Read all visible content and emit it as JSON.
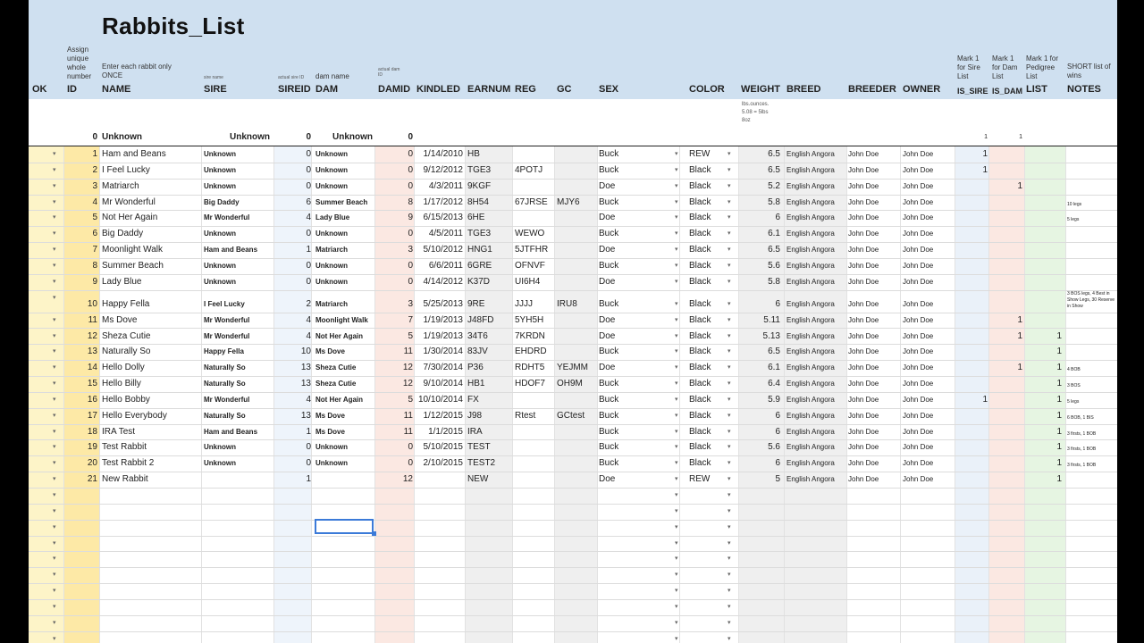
{
  "sheet_title": "Rabbits_List",
  "hints": {
    "id": "Assign\nunique\nwhole\nnumber",
    "name": "Enter each rabbit only\nONCE",
    "sire": "sire name",
    "sireid": "actual sire ID",
    "dam": "dam name",
    "damid": "actual dam\nID",
    "is_sire": "Mark 1\nfor Sire\nList",
    "is_dam": "Mark 1\nfor Dam\nList",
    "pedigree": "Mark 1 for\nPedigree\nList",
    "notes": "SHORT list of\nwins",
    "weight": "lbs.ounces.\n5.08 = 5lbs\n8oz"
  },
  "headers": {
    "ok": "OK",
    "id": "ID",
    "name": "NAME",
    "sire": "SIRE",
    "sireid": "SIREID",
    "dam": "DAM",
    "damid": "DAMID",
    "kindled": "KINDLED",
    "earnum": "EARNUM",
    "reg": "REG",
    "gc": "GC",
    "sex": "SEX",
    "color": "COLOR",
    "weight": "WEIGHT",
    "breed": "BREED",
    "breeder": "BREEDER",
    "owner": "OWNER",
    "is_sire": "IS_SIRE",
    "is_dam": "IS_DAM",
    "list": "LIST",
    "notes": "NOTES"
  },
  "row0": {
    "id": "0",
    "name": "Unknown",
    "sire": "Unknown",
    "sireid": "0",
    "dam": "Unknown",
    "damid": "0",
    "is_sire": "1",
    "is_dam": "1"
  },
  "rows": [
    {
      "id": "1",
      "name": "Ham and Beans",
      "sire": "Unknown",
      "sireid": "0",
      "dam": "Unknown",
      "damid": "0",
      "kindled": "1/14/2010",
      "earnum": "HB",
      "reg": "",
      "gc": "",
      "sex": "Buck",
      "color": "REW",
      "weight": "6.5",
      "breed": "English Angora",
      "breeder": "John Doe",
      "owner": "John Doe",
      "is_sire": "1",
      "is_dam": "",
      "list": "",
      "notes": ""
    },
    {
      "id": "2",
      "name": "I Feel Lucky",
      "sire": "Unknown",
      "sireid": "0",
      "dam": "Unknown",
      "damid": "0",
      "kindled": "9/12/2012",
      "earnum": "TGE3",
      "reg": "4POTJ",
      "gc": "",
      "sex": "Buck",
      "color": "Black",
      "weight": "6.5",
      "breed": "English Angora",
      "breeder": "John Doe",
      "owner": "John Doe",
      "is_sire": "1",
      "is_dam": "",
      "list": "",
      "notes": ""
    },
    {
      "id": "3",
      "name": "Matriarch",
      "sire": "Unknown",
      "sireid": "0",
      "dam": "Unknown",
      "damid": "0",
      "kindled": "4/3/2011",
      "earnum": "9KGF",
      "reg": "",
      "gc": "",
      "sex": "Doe",
      "color": "Black",
      "weight": "5.2",
      "breed": "English Angora",
      "breeder": "John Doe",
      "owner": "John Doe",
      "is_sire": "",
      "is_dam": "1",
      "list": "",
      "notes": ""
    },
    {
      "id": "4",
      "name": "Mr Wonderful",
      "sire": "Big Daddy",
      "sireid": "6",
      "dam": "Summer Beach",
      "damid": "8",
      "kindled": "1/17/2012",
      "earnum": "8H54",
      "reg": "67JRSE",
      "gc": "MJY6",
      "sex": "Buck",
      "color": "Black",
      "weight": "5.8",
      "breed": "English Angora",
      "breeder": "John Doe",
      "owner": "John Doe",
      "is_sire": "",
      "is_dam": "",
      "list": "",
      "notes": "10 legs"
    },
    {
      "id": "5",
      "name": "Not Her Again",
      "sire": "Mr Wonderful",
      "sireid": "4",
      "dam": "Lady Blue",
      "damid": "9",
      "kindled": "6/15/2013",
      "earnum": "6HE",
      "reg": "",
      "gc": "",
      "sex": "Doe",
      "color": "Black",
      "weight": "6",
      "breed": "English Angora",
      "breeder": "John Doe",
      "owner": "John Doe",
      "is_sire": "",
      "is_dam": "",
      "list": "",
      "notes": "5 legs"
    },
    {
      "id": "6",
      "name": "Big Daddy",
      "sire": "Unknown",
      "sireid": "0",
      "dam": "Unknown",
      "damid": "0",
      "kindled": "4/5/2011",
      "earnum": "TGE3",
      "reg": "WEWO",
      "gc": "",
      "sex": "Buck",
      "color": "Black",
      "weight": "6.1",
      "breed": "English Angora",
      "breeder": "John Doe",
      "owner": "John Doe",
      "is_sire": "",
      "is_dam": "",
      "list": "",
      "notes": ""
    },
    {
      "id": "7",
      "name": "Moonlight Walk",
      "sire": "Ham and Beans",
      "sireid": "1",
      "dam": "Matriarch",
      "damid": "3",
      "kindled": "5/10/2012",
      "earnum": "HNG1",
      "reg": "5JTFHR",
      "gc": "",
      "sex": "Doe",
      "color": "Black",
      "weight": "6.5",
      "breed": "English Angora",
      "breeder": "John Doe",
      "owner": "John Doe",
      "is_sire": "",
      "is_dam": "",
      "list": "",
      "notes": ""
    },
    {
      "id": "8",
      "name": "Summer Beach",
      "sire": "Unknown",
      "sireid": "0",
      "dam": "Unknown",
      "damid": "0",
      "kindled": "6/6/2011",
      "earnum": "6GRE",
      "reg": "OFNVF",
      "gc": "",
      "sex": "Buck",
      "color": "Black",
      "weight": "5.6",
      "breed": "English Angora",
      "breeder": "John Doe",
      "owner": "John Doe",
      "is_sire": "",
      "is_dam": "",
      "list": "",
      "notes": ""
    },
    {
      "id": "9",
      "name": "Lady Blue",
      "sire": "Unknown",
      "sireid": "0",
      "dam": "Unknown",
      "damid": "0",
      "kindled": "4/14/2012",
      "earnum": "K37D",
      "reg": "UI6H4",
      "gc": "",
      "sex": "Doe",
      "color": "Black",
      "weight": "5.8",
      "breed": "English Angora",
      "breeder": "John Doe",
      "owner": "John Doe",
      "is_sire": "",
      "is_dam": "",
      "list": "",
      "notes": ""
    },
    {
      "id": "10",
      "name": "Happy Fella",
      "sire": "I Feel Lucky",
      "sireid": "2",
      "dam": "Matriarch",
      "damid": "3",
      "kindled": "5/25/2013",
      "earnum": "9RE",
      "reg": "JJJJ",
      "gc": "IRU8",
      "sex": "Buck",
      "color": "Black",
      "weight": "6",
      "breed": "English Angora",
      "breeder": "John Doe",
      "owner": "John Doe",
      "is_sire": "",
      "is_dam": "",
      "list": "",
      "notes": "3 BOS legs, 4 Best in Show Legs, 30 Reserve in Show"
    },
    {
      "id": "11",
      "name": "Ms Dove",
      "sire": "Mr Wonderful",
      "sireid": "4",
      "dam": "Moonlight Walk",
      "damid": "7",
      "kindled": "1/19/2013",
      "earnum": "J48FD",
      "reg": "5YH5H",
      "gc": "",
      "sex": "Doe",
      "color": "Black",
      "weight": "5.11",
      "breed": "English Angora",
      "breeder": "John Doe",
      "owner": "John Doe",
      "is_sire": "",
      "is_dam": "1",
      "list": "",
      "notes": ""
    },
    {
      "id": "12",
      "name": "Sheza Cutie",
      "sire": "Mr Wonderful",
      "sireid": "4",
      "dam": "Not Her Again",
      "damid": "5",
      "kindled": "1/19/2013",
      "earnum": "34T6",
      "reg": "7KRDN",
      "gc": "",
      "sex": "Doe",
      "color": "Black",
      "weight": "5.13",
      "breed": "English Angora",
      "breeder": "John Doe",
      "owner": "John Doe",
      "is_sire": "",
      "is_dam": "1",
      "list": "1",
      "notes": ""
    },
    {
      "id": "13",
      "name": "Naturally So",
      "sire": "Happy Fella",
      "sireid": "10",
      "dam": "Ms Dove",
      "damid": "11",
      "kindled": "1/30/2014",
      "earnum": "83JV",
      "reg": "EHDRD",
      "gc": "",
      "sex": "Buck",
      "color": "Black",
      "weight": "6.5",
      "breed": "English Angora",
      "breeder": "John Doe",
      "owner": "John Doe",
      "is_sire": "",
      "is_dam": "",
      "list": "1",
      "notes": ""
    },
    {
      "id": "14",
      "name": "Hello Dolly",
      "sire": "Naturally So",
      "sireid": "13",
      "dam": "Sheza Cutie",
      "damid": "12",
      "kindled": "7/30/2014",
      "earnum": "P36",
      "reg": "RDHT5",
      "gc": "YEJMM",
      "sex": "Doe",
      "color": "Black",
      "weight": "6.1",
      "breed": "English Angora",
      "breeder": "John Doe",
      "owner": "John Doe",
      "is_sire": "",
      "is_dam": "1",
      "list": "1",
      "notes": "4 BOB"
    },
    {
      "id": "15",
      "name": "Hello Billy",
      "sire": "Naturally So",
      "sireid": "13",
      "dam": "Sheza Cutie",
      "damid": "12",
      "kindled": "9/10/2014",
      "earnum": "HB1",
      "reg": "HDOF7",
      "gc": "OH9M",
      "sex": "Buck",
      "color": "Black",
      "weight": "6.4",
      "breed": "English Angora",
      "breeder": "John Doe",
      "owner": "John Doe",
      "is_sire": "",
      "is_dam": "",
      "list": "1",
      "notes": "3 BOS"
    },
    {
      "id": "16",
      "name": "Hello Bobby",
      "sire": "Mr Wonderful",
      "sireid": "4",
      "dam": "Not Her Again",
      "damid": "5",
      "kindled": "10/10/2014",
      "earnum": "FX",
      "reg": "",
      "gc": "",
      "sex": "Buck",
      "color": "Black",
      "weight": "5.9",
      "breed": "English Angora",
      "breeder": "John Doe",
      "owner": "John Doe",
      "is_sire": "1",
      "is_dam": "",
      "list": "1",
      "notes": "5 legs"
    },
    {
      "id": "17",
      "name": "Hello Everybody",
      "sire": "Naturally So",
      "sireid": "13",
      "dam": "Ms Dove",
      "damid": "11",
      "kindled": "1/12/2015",
      "earnum": "J98",
      "reg": "Rtest",
      "gc": "GCtest",
      "sex": "Buck",
      "color": "Black",
      "weight": "6",
      "breed": "English Angora",
      "breeder": "John Doe",
      "owner": "John Doe",
      "is_sire": "",
      "is_dam": "",
      "list": "1",
      "notes": "6 BOB, 1 BIS"
    },
    {
      "id": "18",
      "name": "IRA Test",
      "sire": "Ham and Beans",
      "sireid": "1",
      "dam": "Ms Dove",
      "damid": "11",
      "kindled": "1/1/2015",
      "earnum": "IRA",
      "reg": "",
      "gc": "",
      "sex": "Buck",
      "color": "Black",
      "weight": "6",
      "breed": "English Angora",
      "breeder": "John Doe",
      "owner": "John Doe",
      "is_sire": "",
      "is_dam": "",
      "list": "1",
      "notes": "3 firsts, 1 BOB"
    },
    {
      "id": "19",
      "name": "Test Rabbit",
      "sire": "Unknown",
      "sireid": "0",
      "dam": "Unknown",
      "damid": "0",
      "kindled": "5/10/2015",
      "earnum": "TEST",
      "reg": "",
      "gc": "",
      "sex": "Buck",
      "color": "Black",
      "weight": "5.6",
      "breed": "English Angora",
      "breeder": "John Doe",
      "owner": "John Doe",
      "is_sire": "",
      "is_dam": "",
      "list": "1",
      "notes": "3 firsts, 1 BOB"
    },
    {
      "id": "20",
      "name": "Test Rabbit 2",
      "sire": "Unknown",
      "sireid": "0",
      "dam": "Unknown",
      "damid": "0",
      "kindled": "2/10/2015",
      "earnum": "TEST2",
      "reg": "",
      "gc": "",
      "sex": "Buck",
      "color": "Black",
      "weight": "6",
      "breed": "English Angora",
      "breeder": "John Doe",
      "owner": "John Doe",
      "is_sire": "",
      "is_dam": "",
      "list": "1",
      "notes": "3 firsts, 1 BOB"
    },
    {
      "id": "21",
      "name": "New Rabbit",
      "sire": "",
      "sireid": "1",
      "dam": "",
      "damid": "12",
      "kindled": "",
      "earnum": "NEW",
      "reg": "",
      "gc": "",
      "sex": "Doe",
      "color": "REW",
      "weight": "5",
      "breed": "English Angora",
      "breeder": "John Doe",
      "owner": "John Doe",
      "is_sire": "",
      "is_dam": "",
      "list": "1",
      "notes": ""
    }
  ],
  "empty_rows": 10,
  "colors": {
    "header_bg": "#cfe0f0",
    "ok_col": "#fdf4c8",
    "id_col": "#fde9a6",
    "sireid_col": "#eef4fb",
    "damid_col": "#fbe8e2",
    "gray_col": "#efefef",
    "is_sire_col": "#eaf1f9",
    "is_dam_col": "#fbe8e2",
    "list_col": "#e6f5e2",
    "selection": "#3b7ad8"
  },
  "icons": {
    "dropdown": "dropdown-arrow-icon"
  }
}
